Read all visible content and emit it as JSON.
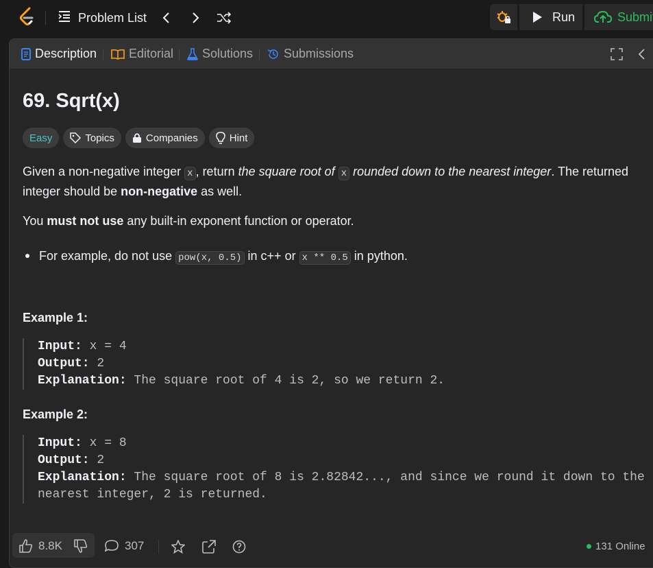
{
  "topbar": {
    "problem_list_label": "Problem List",
    "run_label": "Run",
    "submit_label": "Submit"
  },
  "tabs": [
    {
      "label": "Description",
      "icon": "description-icon",
      "active": true
    },
    {
      "label": "Editorial",
      "icon": "book-icon",
      "active": false
    },
    {
      "label": "Solutions",
      "icon": "flask-icon",
      "active": false
    },
    {
      "label": "Submissions",
      "icon": "history-icon",
      "active": false
    }
  ],
  "problem": {
    "title": "69. Sqrt(x)",
    "difficulty": "Easy",
    "chips": {
      "topics": "Topics",
      "companies": "Companies",
      "hint": "Hint"
    },
    "desc1": {
      "a": "Given a non-negative integer ",
      "code1": "x",
      "b": ", return ",
      "c": "the square root of ",
      "code2": "x",
      "d": " rounded down to the nearest integer",
      "e": ". The returned integer should be ",
      "f": "non-negative",
      "g": " as well."
    },
    "desc2": {
      "a": "You ",
      "b": "must not use",
      "c": " any built-in exponent function or operator."
    },
    "bullet": {
      "a": "For example, do not use ",
      "code1": "pow(x, 0.5)",
      "b": " in c++ or ",
      "code2": "x ** 0.5",
      "c": " in python."
    },
    "examples": [
      {
        "heading": "Example 1:",
        "input_label": "Input:",
        "input_value": " x = 4",
        "output_label": "Output:",
        "output_value": " 2",
        "explanation_label": "Explanation:",
        "explanation_value": " The square root of 4 is 2, so we return 2."
      },
      {
        "heading": "Example 2:",
        "input_label": "Input:",
        "input_value": " x = 8",
        "output_label": "Output:",
        "output_value": " 2",
        "explanation_label": "Explanation:",
        "explanation_value": " The square root of 8 is 2.82842..., and since we round it down to the",
        "explanation_cont": "nearest integer, 2 is returned."
      }
    ]
  },
  "bottom": {
    "likes": "8.8K",
    "comments": "307",
    "online": "131 Online"
  },
  "colors": {
    "accent_green": "#2cbb5d",
    "easy_teal": "#46c6c2",
    "description_blue": "#3b82f6",
    "logo_orange": "#ffa116"
  }
}
